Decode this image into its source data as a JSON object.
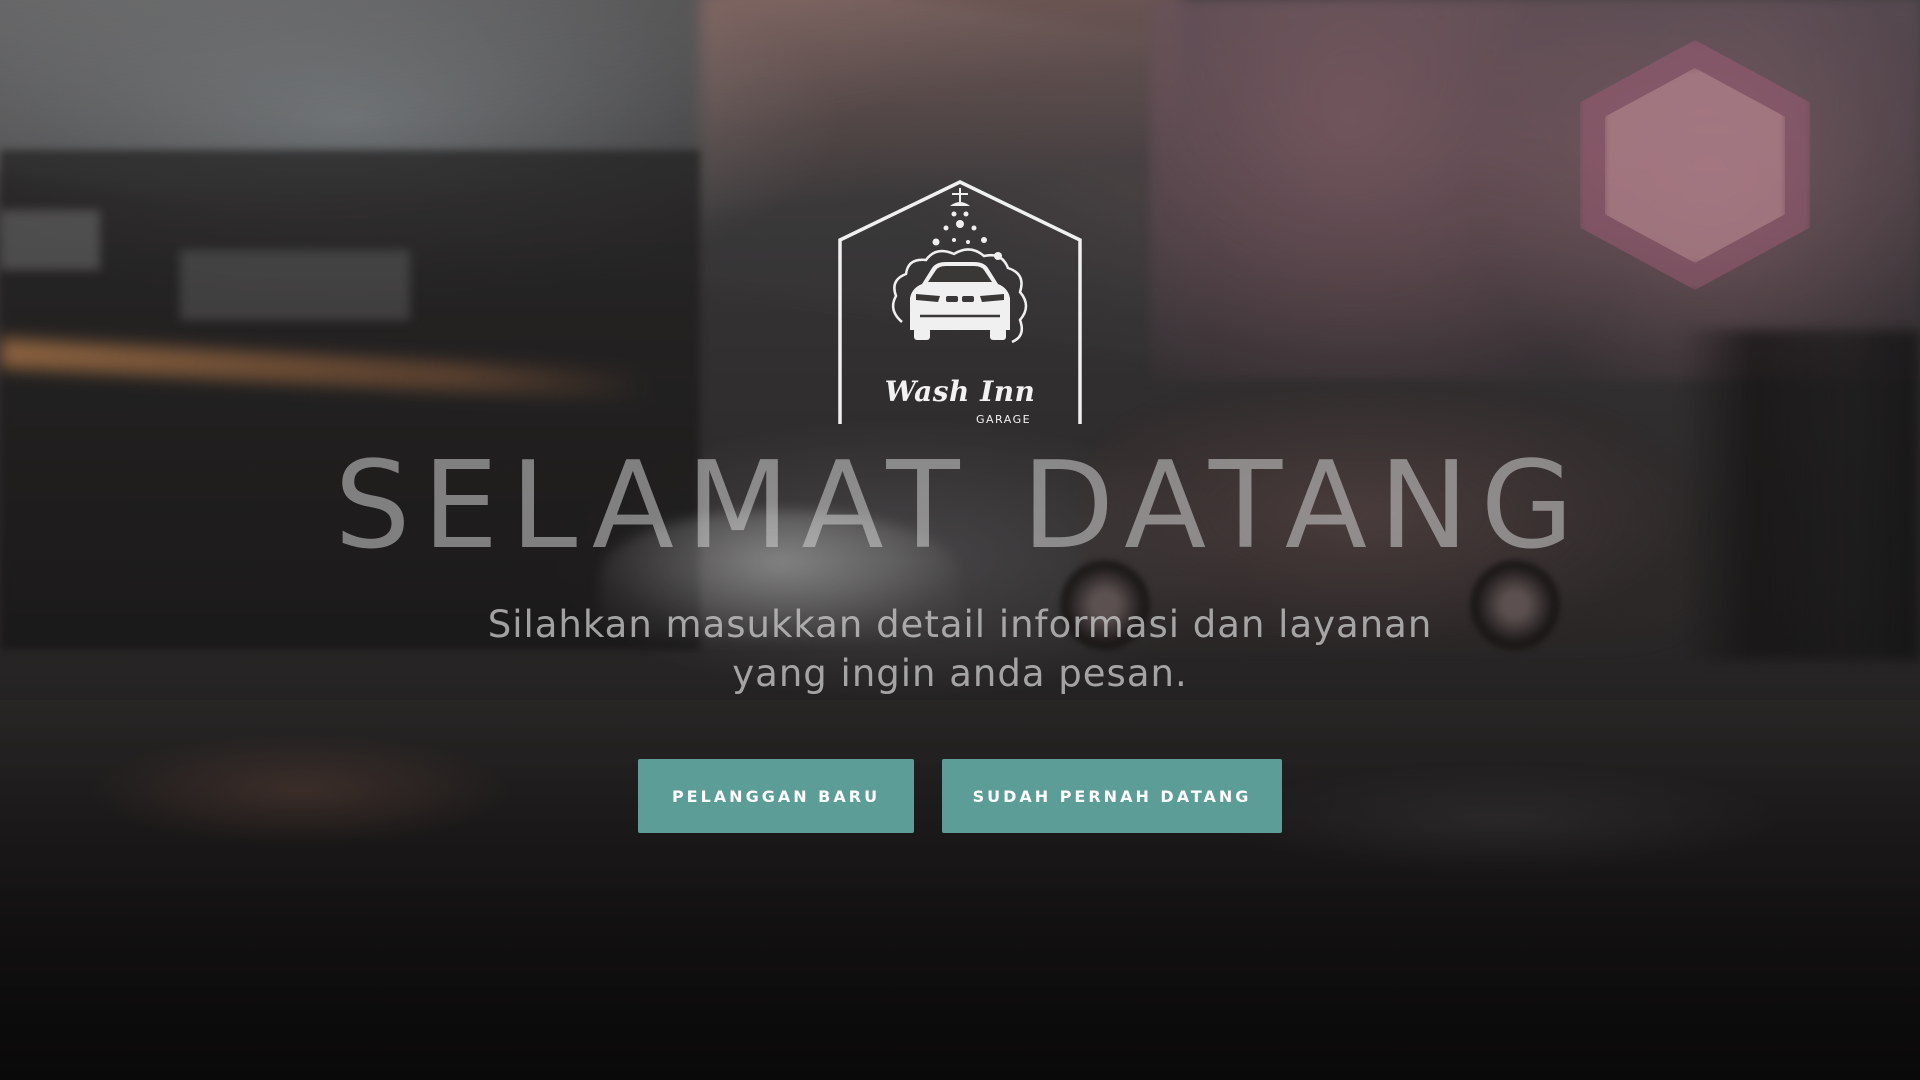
{
  "logo": {
    "brand": "Wash Inn",
    "sub": "GARAGE",
    "icon": "car-wash-house-icon"
  },
  "hero": {
    "headline": "SELAMAT DATANG",
    "subtext_line1": "Silahkan masukkan detail informasi dan layanan",
    "subtext_line2": "yang ingin anda pesan."
  },
  "actions": {
    "new_customer": "PELANGGAN BARU",
    "returning_customer": "SUDAH PERNAH DATANG"
  },
  "colors": {
    "button": "#5d9d97",
    "button_text": "#ffffff",
    "headline": "#d2d2d2"
  }
}
